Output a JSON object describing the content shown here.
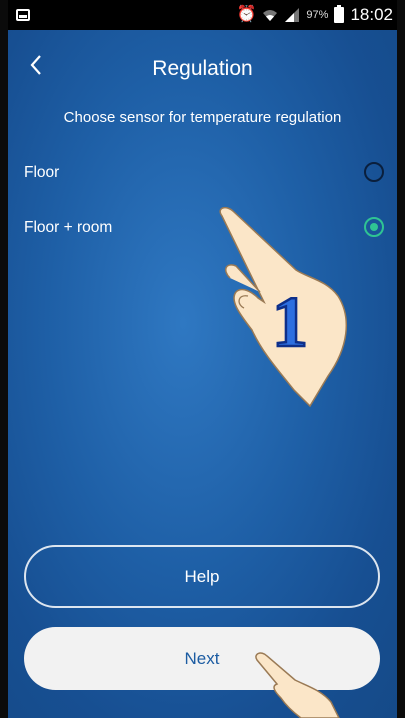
{
  "status_bar": {
    "battery_percent": "97%",
    "time": "18:02",
    "icons": [
      "notification-icon",
      "alarm-icon",
      "wifi-icon",
      "signal-icon",
      "battery-icon"
    ]
  },
  "header": {
    "back_icon": "chevron-left-icon",
    "title": "Regulation"
  },
  "subtitle": "Choose sensor for temperature regulation",
  "options": [
    {
      "label": "Floor",
      "selected": false
    },
    {
      "label": "Floor + room",
      "selected": true
    }
  ],
  "buttons": {
    "help_label": "Help",
    "next_label": "Next"
  },
  "overlay": {
    "step_number": "1"
  },
  "colors": {
    "background": "#1e5fa6",
    "selected_radio": "#2fc493",
    "next_text": "#1c5ca2"
  }
}
